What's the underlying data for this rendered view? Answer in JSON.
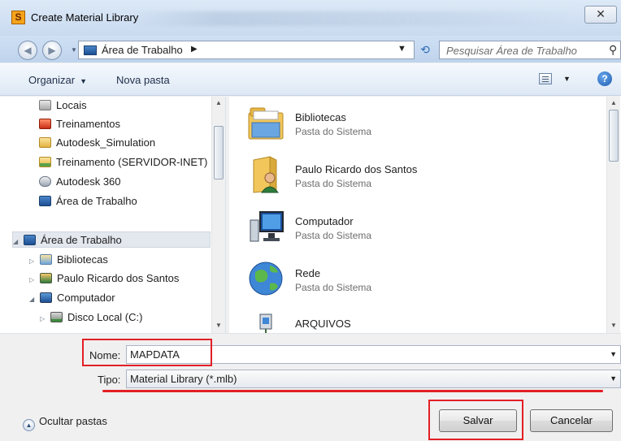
{
  "window": {
    "title": "Create Material Library",
    "app_icon_letter": "S",
    "close_glyph": "✕"
  },
  "address_bar": {
    "location": "Área de Trabalho",
    "search_placeholder": "Pesquisar Área de Trabalho"
  },
  "toolbar": {
    "organize": "Organizar",
    "new_folder": "Nova pasta",
    "help": "?"
  },
  "nav_pane": {
    "items": [
      {
        "label": "Locais",
        "icon": "places-icon"
      },
      {
        "label": "Treinamentos",
        "icon": "treinamentos-icon"
      },
      {
        "label": "Autodesk_Simulation",
        "icon": "folder-icon"
      },
      {
        "label": "Treinamento (SERVIDOR-INET)",
        "icon": "network-folder-icon"
      },
      {
        "label": "Autodesk 360",
        "icon": "cloud-icon"
      },
      {
        "label": "Área de Trabalho",
        "icon": "desktop-icon"
      },
      {
        "label": "Área de Trabalho",
        "icon": "desktop-icon",
        "selected": true
      },
      {
        "label": "Bibliotecas",
        "icon": "libraries-icon"
      },
      {
        "label": "Paulo Ricardo dos Santos",
        "icon": "user-folder-icon"
      },
      {
        "label": "Computador",
        "icon": "computer-icon"
      },
      {
        "label": "Disco Local (C:)",
        "icon": "local-disk-icon"
      }
    ]
  },
  "files": [
    {
      "name": "Bibliotecas",
      "type": "Pasta do Sistema",
      "icon": "libraries-icon"
    },
    {
      "name": "Paulo Ricardo dos Santos",
      "type": "Pasta do Sistema",
      "icon": "user-folder-icon"
    },
    {
      "name": "Computador",
      "type": "Pasta do Sistema",
      "icon": "computer-icon"
    },
    {
      "name": "Rede",
      "type": "Pasta do Sistema",
      "icon": "network-globe-icon"
    },
    {
      "name": "ARQUIVOS",
      "type": "",
      "icon": "network-share-icon"
    }
  ],
  "form": {
    "name_label": "Nome:",
    "name_value": "MAPDATA",
    "type_label": "Tipo:",
    "type_value": "Material Library (*.mlb)"
  },
  "footer": {
    "hide_folders": "Ocultar pastas",
    "save": "Salvar",
    "cancel": "Cancelar"
  },
  "colors": {
    "highlight_red": "#e21f26",
    "accent_blue": "#1d4f94"
  }
}
